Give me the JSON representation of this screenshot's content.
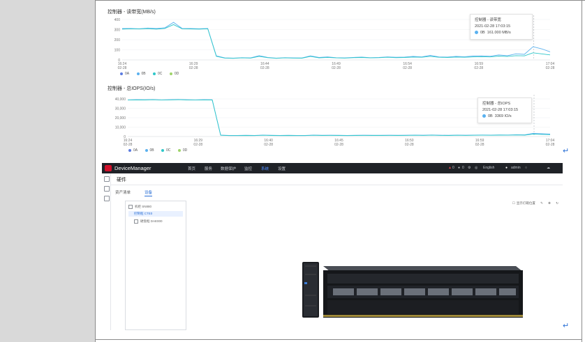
{
  "doc": {
    "return_mark": "↵"
  },
  "chart1": {
    "title": "控制器 - 读带宽(MB/s)",
    "tooltip": {
      "title": "控制器 - 读带宽",
      "time": "2021-02-28 17:03:15",
      "series": "0B",
      "value": "161.000 MB/s"
    }
  },
  "chart2": {
    "title": "控制器 - 总IOPS(IO/s)",
    "tooltip": {
      "title": "控制器 - 总IOPS",
      "time": "2021-02-28 17:03:15",
      "series": "0B",
      "value": "3369 IO/s"
    }
  },
  "legend": [
    {
      "name": "0A",
      "color": "#5b7be0"
    },
    {
      "name": "0B",
      "color": "#5ab1ef"
    },
    {
      "name": "0C",
      "color": "#2ec7c9"
    },
    {
      "name": "0D",
      "color": "#9fd46a"
    }
  ],
  "chart_data": [
    {
      "type": "line",
      "title": "控制器 - 读带宽(MB/s)",
      "xlabel": "",
      "ylabel": "",
      "ylim": [
        0,
        400
      ],
      "yticks": [
        "400",
        "300",
        "200",
        "100",
        "0"
      ],
      "xticks": [
        {
          "time": "16:24",
          "date": "02-28"
        },
        {
          "time": "16:29",
          "date": "02-28"
        },
        {
          "time": "16:44",
          "date": "02-28"
        },
        {
          "time": "16:49",
          "date": "02-28"
        },
        {
          "time": "16:54",
          "date": "02-28"
        },
        {
          "time": "16:59",
          "date": "02-28"
        },
        {
          "time": "17:04",
          "date": "02-28"
        }
      ],
      "grid": true,
      "legend_position": "bottom-left",
      "series": [
        {
          "name": "0B",
          "values": [
            310,
            312,
            308,
            315,
            310,
            318,
            372,
            312,
            310,
            308,
            312,
            40,
            20,
            18,
            22,
            20,
            42,
            25,
            18,
            22,
            20,
            19,
            40,
            24,
            30,
            22,
            20,
            25,
            28,
            22,
            24,
            30,
            26,
            28,
            35,
            30,
            45,
            30,
            28,
            35,
            32,
            38,
            40,
            36,
            50,
            42,
            60,
            55,
            130,
            110,
            80
          ]
        },
        {
          "name": "0C",
          "values": [
            305,
            308,
            306,
            310,
            305,
            312,
            350,
            308,
            306,
            305,
            308,
            35,
            18,
            16,
            20,
            18,
            35,
            22,
            16,
            20,
            18,
            17,
            35,
            20,
            25,
            20,
            18,
            22,
            24,
            20,
            22,
            26,
            22,
            24,
            28,
            26,
            35,
            26,
            24,
            28,
            26,
            30,
            32,
            30,
            38,
            34,
            42,
            40,
            70,
            60,
            50
          ]
        }
      ]
    },
    {
      "type": "line",
      "title": "控制器 - 总IOPS(IO/s)",
      "xlabel": "",
      "ylabel": "",
      "ylim": [
        0,
        40000
      ],
      "yticks": [
        "40,000",
        "30,000",
        "20,000",
        "10,000",
        "0"
      ],
      "xticks": [
        {
          "time": "16:24",
          "date": "02-28"
        },
        {
          "time": "16:29",
          "date": "02-28"
        },
        {
          "time": "16:40",
          "date": "02-28"
        },
        {
          "time": "16:45",
          "date": "02-28"
        },
        {
          "time": "16:50",
          "date": "02-28"
        },
        {
          "time": "16:59",
          "date": "02-28"
        },
        {
          "time": "17:04",
          "date": "02-28"
        }
      ],
      "grid": true,
      "legend_position": "bottom-left",
      "series": [
        {
          "name": "0B",
          "values": [
            39000,
            39200,
            39100,
            39300,
            39000,
            39200,
            39400,
            39100,
            39000,
            39200,
            39100,
            1500,
            1200,
            1100,
            1300,
            1200,
            1500,
            1300,
            1200,
            1300,
            1200,
            1100,
            1500,
            1300,
            1400,
            1300,
            1200,
            1300,
            1400,
            1300,
            1300,
            1400,
            1300,
            1400,
            1500,
            1400,
            1600,
            1400,
            1300,
            1500,
            1400,
            1500,
            1600,
            1500,
            1700,
            1600,
            1900,
            1800,
            3369,
            3000,
            2600
          ]
        },
        {
          "name": "0C",
          "values": [
            38800,
            39000,
            38900,
            39100,
            38800,
            39000,
            39200,
            38900,
            38800,
            39000,
            38900,
            1300,
            1000,
            950,
            1100,
            1000,
            1300,
            1100,
            1000,
            1100,
            1000,
            950,
            1300,
            1100,
            1200,
            1100,
            1000,
            1100,
            1200,
            1100,
            1100,
            1200,
            1100,
            1200,
            1300,
            1200,
            1400,
            1200,
            1100,
            1300,
            1200,
            1300,
            1400,
            1300,
            1500,
            1400,
            1600,
            1500,
            2600,
            2300,
            2000
          ]
        }
      ]
    }
  ],
  "dm": {
    "brand": "DeviceManager",
    "nav": [
      "首页",
      "服务",
      "数据保护",
      "监控",
      "系统",
      "设置"
    ],
    "nav_active": 4,
    "alerts": [
      "0",
      "0"
    ],
    "language": "English",
    "user": "admin",
    "header_title": "硬件",
    "tabs": [
      "资产清单",
      "设备"
    ],
    "tab_active": 1,
    "tree": [
      {
        "label": "机柜 SN880",
        "level": 0
      },
      {
        "label": "控制框 CTE0",
        "level": 1,
        "selected": true
      },
      {
        "label": "硬盘框 DAE000",
        "level": 1
      }
    ],
    "tools_label": "显示灯箱位置"
  }
}
